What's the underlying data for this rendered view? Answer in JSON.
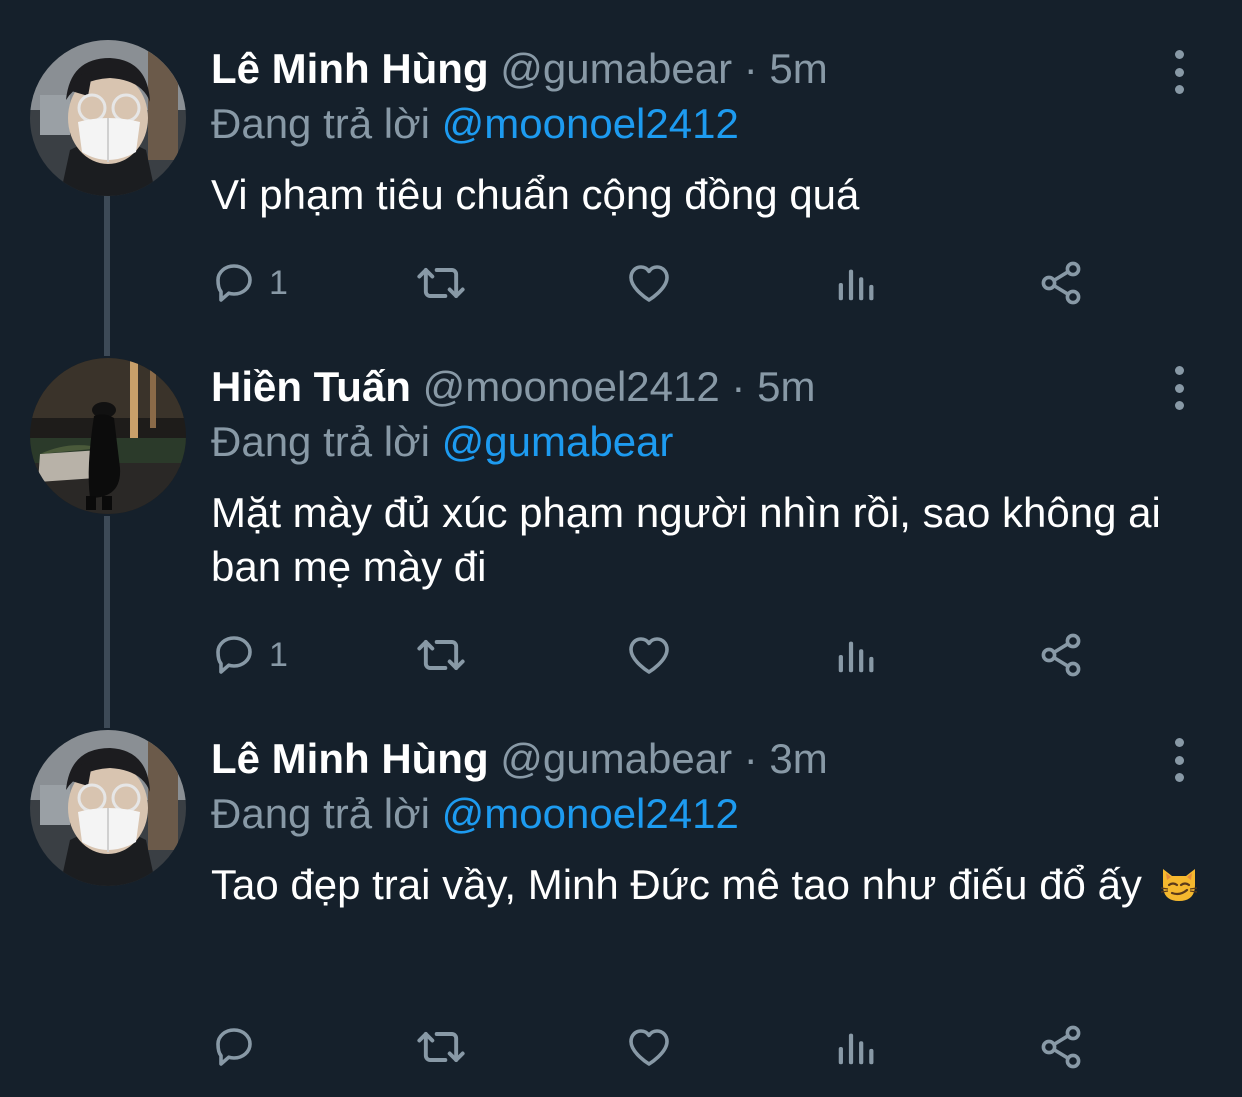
{
  "colors": {
    "background": "#15202b",
    "secondary_text": "#8899a6",
    "mention": "#1d9bf0",
    "thread_line": "#3d4a57"
  },
  "tweets": [
    {
      "name": "Lê Minh Hùng",
      "handle": "@gumabear",
      "separator": "·",
      "time": "5m",
      "reply_prefix": "Đang trả lời",
      "reply_to": "@moonoel2412",
      "text": "Vi phạm tiêu chuẩn cộng đồng quá",
      "reply_count": "1",
      "avatar": "person-wearing-mask-and-glasses-photo"
    },
    {
      "name": "Hiền Tuấn",
      "handle": "@moonoel2412",
      "separator": "·",
      "time": "5m",
      "reply_prefix": "Đang trả lời",
      "reply_to": "@gumabear",
      "text": "Mặt mày đủ xúc phạm người nhìn rồi, sao không ai ban mẹ mày đi",
      "reply_count": "1",
      "avatar": "person-in-black-coat-at-night-photo"
    },
    {
      "name": "Lê Minh Hùng",
      "handle": "@gumabear",
      "separator": "·",
      "time": "3m",
      "reply_prefix": "Đang trả lời",
      "reply_to": "@moonoel2412",
      "text": "Tao đẹp trai vầy, Minh Đức mê tao như điếu đổ ấy",
      "emoji": "smirking-cat-face-emoji",
      "reply_count": "",
      "avatar": "person-wearing-mask-and-glasses-photo"
    }
  ],
  "action_icons": [
    "reply-icon",
    "retweet-icon",
    "like-icon",
    "analytics-icon",
    "share-icon"
  ]
}
